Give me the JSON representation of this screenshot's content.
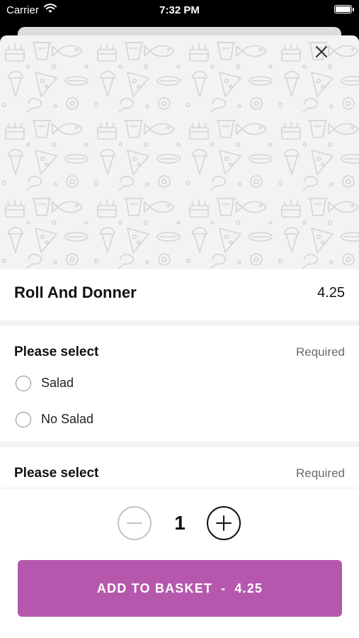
{
  "status_bar": {
    "carrier": "Carrier",
    "time": "7:32 PM",
    "wifi_icon": "wifi-icon",
    "battery_icon": "battery-icon"
  },
  "hero": {
    "background_pattern": "food-doodle-pattern",
    "close_icon": "close-icon"
  },
  "item": {
    "name": "Roll And Donner",
    "price": "4.25"
  },
  "option_groups": [
    {
      "title": "Please select",
      "requirement": "Required",
      "options": [
        {
          "label": "Salad",
          "selected": false
        },
        {
          "label": "No Salad",
          "selected": false
        }
      ]
    },
    {
      "title": "Please select",
      "requirement": "Required",
      "options": []
    }
  ],
  "quantity": {
    "value": "1",
    "minus_icon": "minus-icon",
    "plus_icon": "plus-icon"
  },
  "add_to_basket": {
    "label": "ADD TO BASKET",
    "separator": "-",
    "price": "4.25",
    "color": "#b558ad"
  }
}
